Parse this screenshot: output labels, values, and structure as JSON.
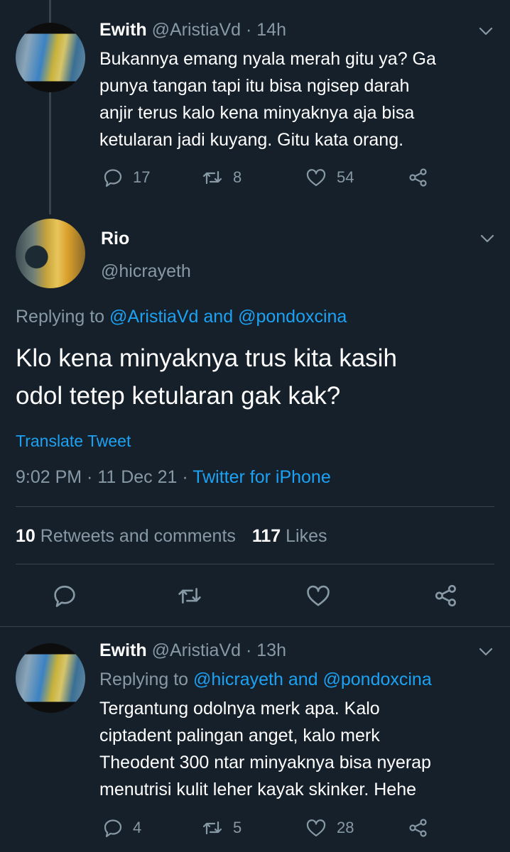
{
  "tweet1": {
    "name": "Ewith",
    "handle": "@AristiaVd",
    "separator": "·",
    "time": "14h",
    "text_lines": [
      "Bukannya emang nyala merah gitu ya? Ga",
      "punya tangan tapi itu bisa ngisep darah",
      "anjir terus kalo kena minyaknya aja bisa",
      "ketularan jadi kuyang. Gitu kata orang."
    ],
    "replies": "17",
    "retweets": "8",
    "likes": "54"
  },
  "main_tweet": {
    "name": "Rio",
    "handle": "@hicrayeth",
    "replying_prefix": "Replying to",
    "replying_user1": "@AristiaVd",
    "replying_and": "and",
    "replying_user2": "@pondoxcina",
    "text_lines": [
      "Klo kena minyaknya trus kita kasih",
      "odol tetep ketularan gak kak?"
    ],
    "translate": "Translate Tweet",
    "timestamp": "9:02 PM · 11 Dec 21 ·",
    "client": "Twitter for iPhone",
    "retweets_count": "10",
    "retweets_label": "Retweets and comments",
    "likes_count": "117",
    "likes_label": "Likes"
  },
  "tweet3": {
    "name": "Ewith",
    "handle": "@AristiaVd",
    "separator": "·",
    "time": "13h",
    "replying_prefix": "Replying to",
    "replying_user1": "@hicrayeth",
    "replying_and": "and",
    "replying_user2": "@pondoxcina",
    "text_lines": [
      "Tergantung odolnya merk apa. Kalo",
      "ciptadent palingan anget, kalo merk",
      "Theodent 300 ntar minyaknya bisa nyerap",
      "menutrisi kulit leher kayak skinker. Hehe"
    ],
    "replies": "4",
    "retweets": "5",
    "likes": "28"
  },
  "colors": {
    "background": "#15202b",
    "muted": "#8899a6",
    "link": "#1da1f2",
    "divider": "#38444d"
  },
  "icons": [
    "reply-icon",
    "retweet-icon",
    "like-icon",
    "share-icon",
    "chevron-down-icon"
  ]
}
